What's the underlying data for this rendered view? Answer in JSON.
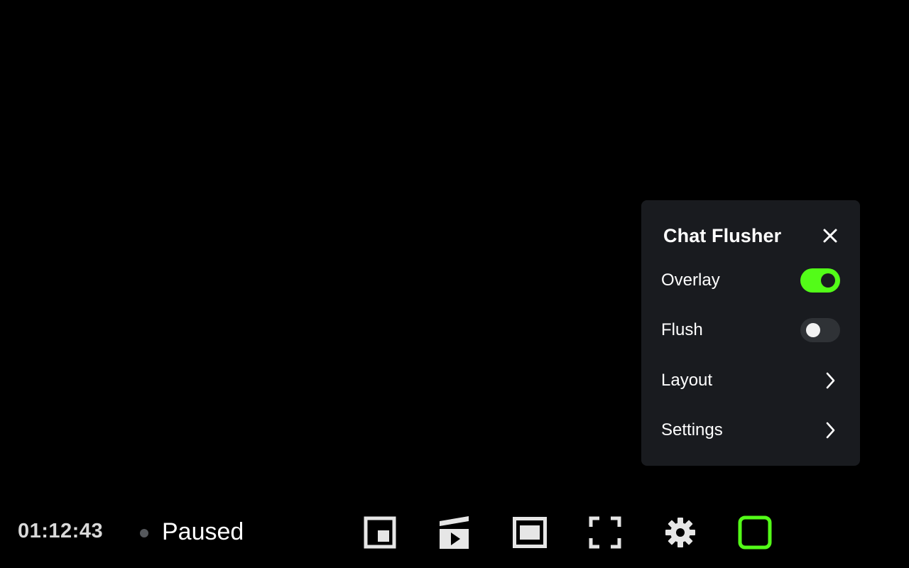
{
  "panel": {
    "title": "Chat Flusher",
    "close_icon": "close-icon",
    "rows": [
      {
        "label": "Overlay",
        "control": "toggle",
        "state": "on"
      },
      {
        "label": "Flush",
        "control": "toggle",
        "state": "off"
      },
      {
        "label": "Layout",
        "control": "chevron-right-icon"
      },
      {
        "label": "Settings",
        "control": "chevron-right-icon"
      }
    ]
  },
  "player": {
    "time": "01:12:43",
    "status": "Paused",
    "controls": [
      {
        "icon": "picture-in-picture-icon"
      },
      {
        "icon": "clip-icon"
      },
      {
        "icon": "theater-mode-icon"
      },
      {
        "icon": "fullscreen-icon"
      },
      {
        "icon": "gear-icon"
      },
      {
        "icon": "chat-flusher-icon",
        "active": true
      }
    ]
  },
  "colors": {
    "accent": "#53fc18",
    "panel_bg": "#191b1f",
    "background": "#000000",
    "toggle_off": "#2f3236",
    "icon": "#e6e6e6"
  }
}
